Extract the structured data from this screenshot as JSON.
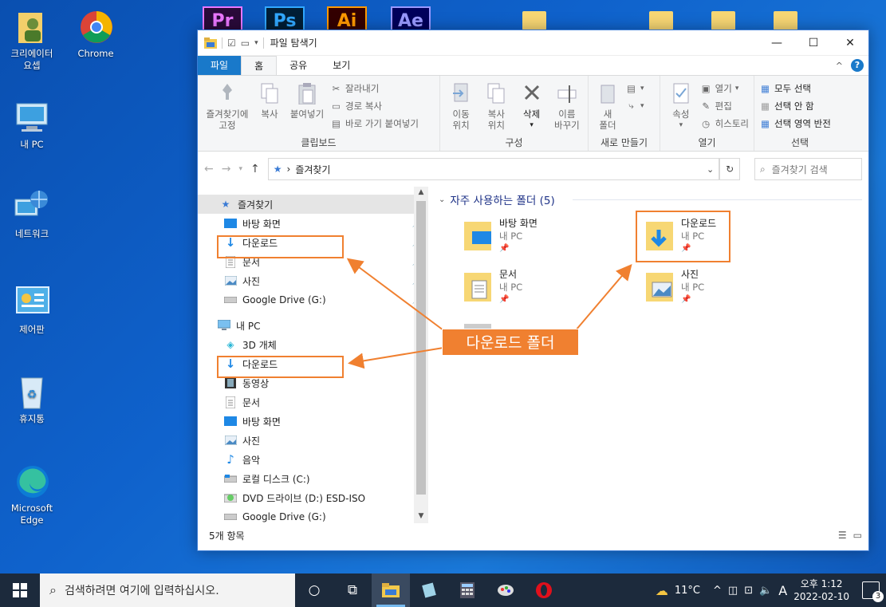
{
  "desktop": {
    "icons": [
      {
        "label": "크리에이터\n요셉"
      },
      {
        "label": "Chrome"
      },
      {
        "label": "내 PC"
      },
      {
        "label": "네트워크"
      },
      {
        "label": "제어판"
      },
      {
        "label": "휴지통"
      },
      {
        "label": "Microsoft Edge"
      }
    ],
    "top_apps": [
      {
        "label": "Pr",
        "color": "#ea77ff",
        "bg": "#2a0a3a"
      },
      {
        "label": "Ps",
        "color": "#31a8ff",
        "bg": "#001e36"
      },
      {
        "label": "Ai",
        "color": "#ff9a00",
        "bg": "#330000"
      },
      {
        "label": "Ae",
        "color": "#9999ff",
        "bg": "#00005b"
      }
    ]
  },
  "window": {
    "title": "파일 탐색기",
    "tabs": [
      "파일",
      "홈",
      "공유",
      "보기"
    ],
    "ribbon": {
      "clipboard": {
        "label": "클립보드",
        "pin": "즐겨찾기에\n고정",
        "copy": "복사",
        "paste": "붙여넣기",
        "cut": "잘라내기",
        "copy_path": "경로 복사",
        "paste_shortcut": "바로 가기 붙여넣기"
      },
      "organize": {
        "label": "구성",
        "move_to": "이동\n위치",
        "copy_to": "복사\n위치",
        "delete": "삭제",
        "rename": "이름\n바꾸기"
      },
      "new": {
        "label": "새로 만들기",
        "new_folder": "새\n폴더"
      },
      "open": {
        "label": "열기",
        "properties": "속성",
        "open": "열기",
        "edit": "편집",
        "history": "히스토리"
      },
      "select": {
        "label": "선택",
        "select_all": "모두 선택",
        "select_none": "선택 안 함",
        "invert": "선택 영역 반전"
      }
    },
    "address": {
      "path": "즐겨찾기",
      "search_placeholder": "즐겨찾기 검색"
    },
    "nav": {
      "quick_access": "즐겨찾기",
      "quick_items": [
        "바탕 화면",
        "다운로드",
        "문서",
        "사진",
        "Google Drive (G:)"
      ],
      "this_pc": "내 PC",
      "pc_items": [
        "3D 개체",
        "다운로드",
        "동영상",
        "문서",
        "바탕 화면",
        "사진",
        "음악",
        "로컬 디스크 (C:)",
        "DVD 드라이브 (D:) ESD-ISO",
        "Google Drive (G:)"
      ]
    },
    "content": {
      "group_title": "자주 사용하는 폴더 (5)",
      "tiles": [
        {
          "name": "바탕 화면",
          "loc": "내 PC"
        },
        {
          "name": "다운로드",
          "loc": "내 PC"
        },
        {
          "name": "문서",
          "loc": "내 PC"
        },
        {
          "name": "사진",
          "loc": "내 PC"
        }
      ]
    },
    "status": "5개 항목"
  },
  "annotation": {
    "callout": "다운로드 폴더",
    "color": "#f08030"
  },
  "taskbar": {
    "search_placeholder": "검색하려면 여기에 입력하십시오.",
    "weather": "11°C",
    "ime": "A",
    "time": "오후 1:12",
    "date": "2022-02-10",
    "notifications": "3"
  }
}
